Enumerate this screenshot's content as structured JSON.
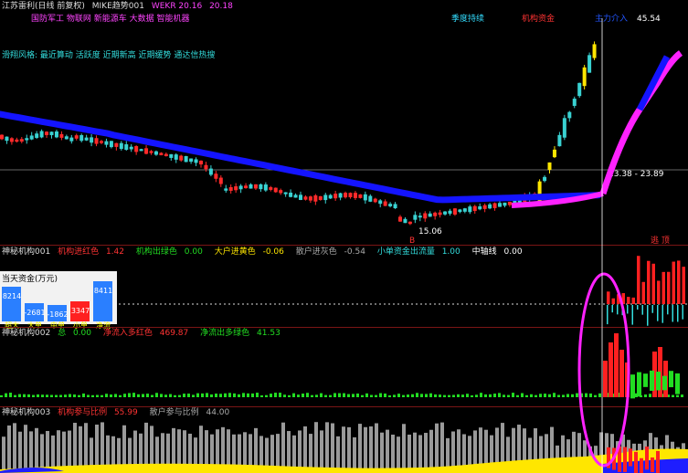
{
  "colors": {
    "up": "#ff2a2a",
    "down": "#39d2d2",
    "ma": "#1414ff",
    "ma_hot": "#ff22ff",
    "yellow": "#ffe600",
    "green": "#22dd22",
    "gray": "#9a9a9a",
    "cyan": "#33dddd",
    "red": "#ff2020"
  },
  "panel_main": {
    "title_parts": [
      "江苏雷利(日线 前复权)",
      "MIKE趋势001",
      "WEKR 20.16",
      "20.18"
    ],
    "strategy_line": "国防军工 物联网 新能源车 大数据 智能机器",
    "style_line": "滑翔风格: 最近算动 活跃度 近期新高 近期缓势 通达信热搜",
    "tag_left": "季度持续",
    "tag_mid": "机构资金",
    "tag_right": "主力介入",
    "high_label": "45.54",
    "low_label": "15.06",
    "crosshair_label": "23.38 - 23.89",
    "marker_left": "B",
    "marker_right": "逃 顶"
  },
  "panel_jg1": {
    "name": "神秘机构001",
    "items": [
      {
        "label": "机构进红色",
        "value": "1.42"
      },
      {
        "label": "机构出绿色",
        "value": "0.00"
      },
      {
        "label": "大户进黄色",
        "value": "-0.06"
      },
      {
        "label": "散户进灰色",
        "value": "-0.54"
      },
      {
        "label": "小单资金出流量",
        "value": "1.00"
      },
      {
        "label": "中轴线",
        "value": "0.00"
      }
    ],
    "box_title": "当天资金(万元)",
    "funds": [
      {
        "label": "超大",
        "value": "8214",
        "color": "#2a7fff"
      },
      {
        "label": "大单",
        "value": "-2681",
        "color": "#2a7fff"
      },
      {
        "label": "中单",
        "value": "-1862",
        "color": "#2a7fff"
      },
      {
        "label": "小单",
        "value": "3347",
        "color": "#ff2020"
      },
      {
        "label": "净流",
        "value": "8411",
        "color": "#2a7fff"
      }
    ]
  },
  "panel_jg2": {
    "name": "神秘机构002",
    "items": [
      {
        "label": "总",
        "value": "0.00"
      },
      {
        "label": "净流入多红色",
        "value": "469.87"
      },
      {
        "label": "净流出多绿色",
        "value": "41.53"
      }
    ]
  },
  "panel_jg3": {
    "name": "神秘机构003",
    "items": [
      {
        "label": "机构参与比例",
        "value": "55.99"
      },
      {
        "label": "散户参与比例",
        "value": "44.00"
      }
    ]
  },
  "chart_data": {
    "type": "candlestick",
    "y_range": [
      15.06,
      45.54
    ],
    "candles_count": 120,
    "notes": "Daily candlesticks with blue trend MA; last ~15 bars rally from ~20 to ~45.54"
  }
}
